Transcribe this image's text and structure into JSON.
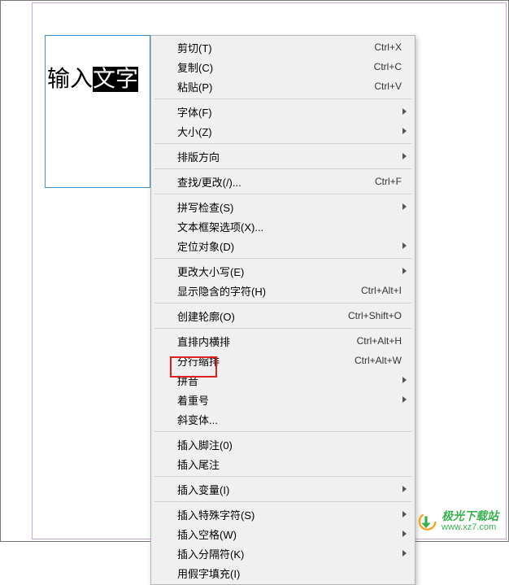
{
  "text_frame": {
    "plain": "输入",
    "selected": "文字"
  },
  "menu": {
    "items": [
      {
        "label": "剪切(T)",
        "shortcut": "Ctrl+X",
        "name": "cut"
      },
      {
        "label": "复制(C)",
        "shortcut": "Ctrl+C",
        "name": "copy"
      },
      {
        "label": "粘贴(P)",
        "shortcut": "Ctrl+V",
        "name": "paste"
      },
      {
        "sep": true
      },
      {
        "label": "字体(F)",
        "submenu": true,
        "name": "font"
      },
      {
        "label": "大小(Z)",
        "submenu": true,
        "name": "size"
      },
      {
        "sep": true
      },
      {
        "label": "排版方向",
        "submenu": true,
        "name": "text-direction"
      },
      {
        "sep": true
      },
      {
        "label": "查找/更改(/)...",
        "shortcut": "Ctrl+F",
        "name": "find-change"
      },
      {
        "sep": true
      },
      {
        "label": "拼写检查(S)",
        "submenu": true,
        "name": "spell-check"
      },
      {
        "label": "文本框架选项(X)...",
        "name": "text-frame-options"
      },
      {
        "label": "定位对象(D)",
        "submenu": true,
        "name": "anchored-object"
      },
      {
        "sep": true
      },
      {
        "label": "更改大小写(E)",
        "submenu": true,
        "name": "change-case"
      },
      {
        "label": "显示隐含的字符(H)",
        "shortcut": "Ctrl+Alt+I",
        "name": "show-hidden-chars"
      },
      {
        "sep": true
      },
      {
        "label": "创建轮廓(O)",
        "shortcut": "Ctrl+Shift+O",
        "name": "create-outlines"
      },
      {
        "sep": true
      },
      {
        "label": "直排内横排",
        "shortcut": "Ctrl+Alt+H",
        "name": "tate-chu-yoko"
      },
      {
        "label": "分行缩排",
        "shortcut": "Ctrl+Alt+W",
        "name": "warichu"
      },
      {
        "label": "拼音",
        "submenu": true,
        "name": "ruby"
      },
      {
        "label": "着重号",
        "submenu": true,
        "name": "kenten"
      },
      {
        "label": "斜变体...",
        "name": "shatai"
      },
      {
        "sep": true
      },
      {
        "label": "插入脚注(0)",
        "name": "insert-footnote"
      },
      {
        "label": "插入尾注",
        "name": "insert-endnote"
      },
      {
        "sep": true
      },
      {
        "label": "插入变量(I)",
        "submenu": true,
        "name": "insert-variable"
      },
      {
        "sep": true
      },
      {
        "label": "插入特殊字符(S)",
        "submenu": true,
        "name": "insert-special-char"
      },
      {
        "label": "插入空格(W)",
        "submenu": true,
        "name": "insert-whitespace"
      },
      {
        "label": "插入分隔符(K)",
        "submenu": true,
        "name": "insert-break-char"
      },
      {
        "label": "用假字填充(I)",
        "name": "fill-placeholder"
      }
    ]
  },
  "watermark": {
    "title": "极光下载站",
    "url": "www.xz7.com"
  },
  "colors": {
    "highlight": "#e02020",
    "frame_border": "#3a97d4",
    "page_border": "#c8a6d6",
    "watermark": "#37b24d"
  }
}
